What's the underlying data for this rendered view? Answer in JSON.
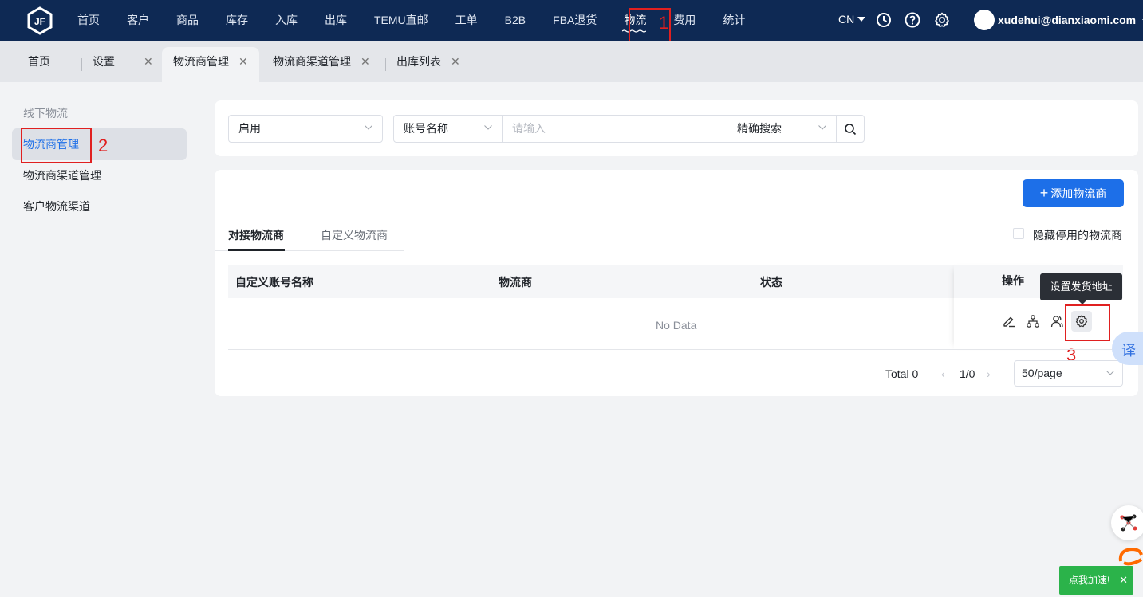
{
  "nav": {
    "items": [
      "首页",
      "客户",
      "商品",
      "库存",
      "入库",
      "出库",
      "TEMU直邮",
      "工单",
      "B2B",
      "FBA退货",
      "物流",
      "费用",
      "统计"
    ],
    "active_index": 10,
    "lang": "CN",
    "user": "xudehui@dianxiaomi.com"
  },
  "tabs": {
    "home": "首页",
    "items": [
      "设置",
      "物流商管理",
      "物流商渠道管理",
      "出库列表"
    ],
    "active_index": 1
  },
  "sidebar": {
    "title": "线下物流",
    "items": [
      "物流商管理",
      "物流商渠道管理",
      "客户物流渠道"
    ],
    "active_index": 0
  },
  "filters": {
    "status": "启用",
    "field": "账号名称",
    "placeholder": "请输入",
    "mode": "精确搜索"
  },
  "main": {
    "add_button": "添加物流商",
    "subtabs": [
      "对接物流商",
      "自定义物流商"
    ],
    "hide_disabled_label": "隐藏停用的物流商",
    "columns": [
      "自定义账号名称",
      "物流商",
      "状态",
      "操作"
    ],
    "empty_text": "No Data",
    "tooltip": "设置发货地址"
  },
  "pagination": {
    "total_label": "Total 0",
    "page": "1/0",
    "page_size": "50/page"
  },
  "annotations": [
    "1",
    "2",
    "3"
  ],
  "widgets": {
    "translate": "译",
    "speed_button": "点我加速!",
    "close": "✕"
  },
  "colors": {
    "topbar": "#0e2954",
    "accent": "#1d6fe8",
    "annotation": "#e02020",
    "speed_button": "#2bb34a"
  }
}
